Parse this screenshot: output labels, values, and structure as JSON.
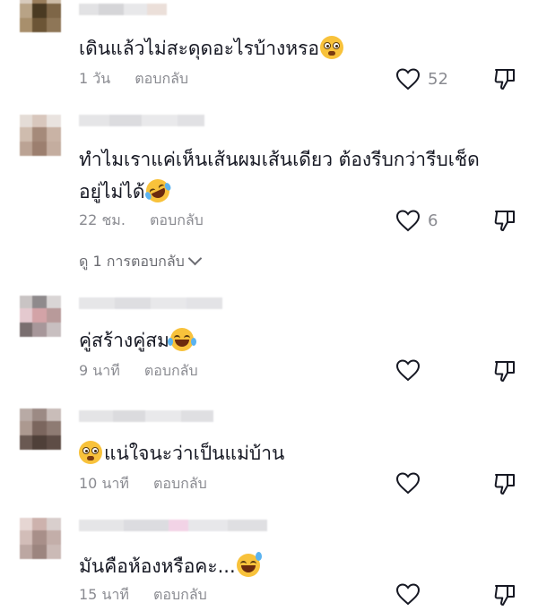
{
  "reply_label": "ตอบกลับ",
  "comments": [
    {
      "text": "เดินแล้วไม่สะดุดอะไรบ้างหรอ",
      "emoji": "flushed-face",
      "time": "1 วัน",
      "likes": "52"
    },
    {
      "text_line1": "ทำไมเราแค่เห็นเส้นผมเส้นเดียว ต้องรีบกว่ารีบเช็ด",
      "text_line2": "อยู่ไม่ได้",
      "emoji": "rolling-laughing-face",
      "time": "22 ชม.",
      "likes": "6",
      "view_replies": "ดู 1 การตอบกลับ"
    },
    {
      "text": "คู่สร้างคู่สม",
      "emoji": "tears-of-joy-face",
      "time": "9 นาที",
      "likes": ""
    },
    {
      "text": "แน่ใจนะว่าเป็นแม่บ้าน",
      "emoji": "flushed-face",
      "time": "10 นาที",
      "likes": ""
    },
    {
      "text": "มันคือห้องหรือคะ...",
      "emoji": "grinning-sweat-face",
      "time": "15 นาที",
      "likes": ""
    }
  ],
  "colors": {
    "text": "#161823",
    "meta": "#8a8b91",
    "icon": "#161823"
  }
}
